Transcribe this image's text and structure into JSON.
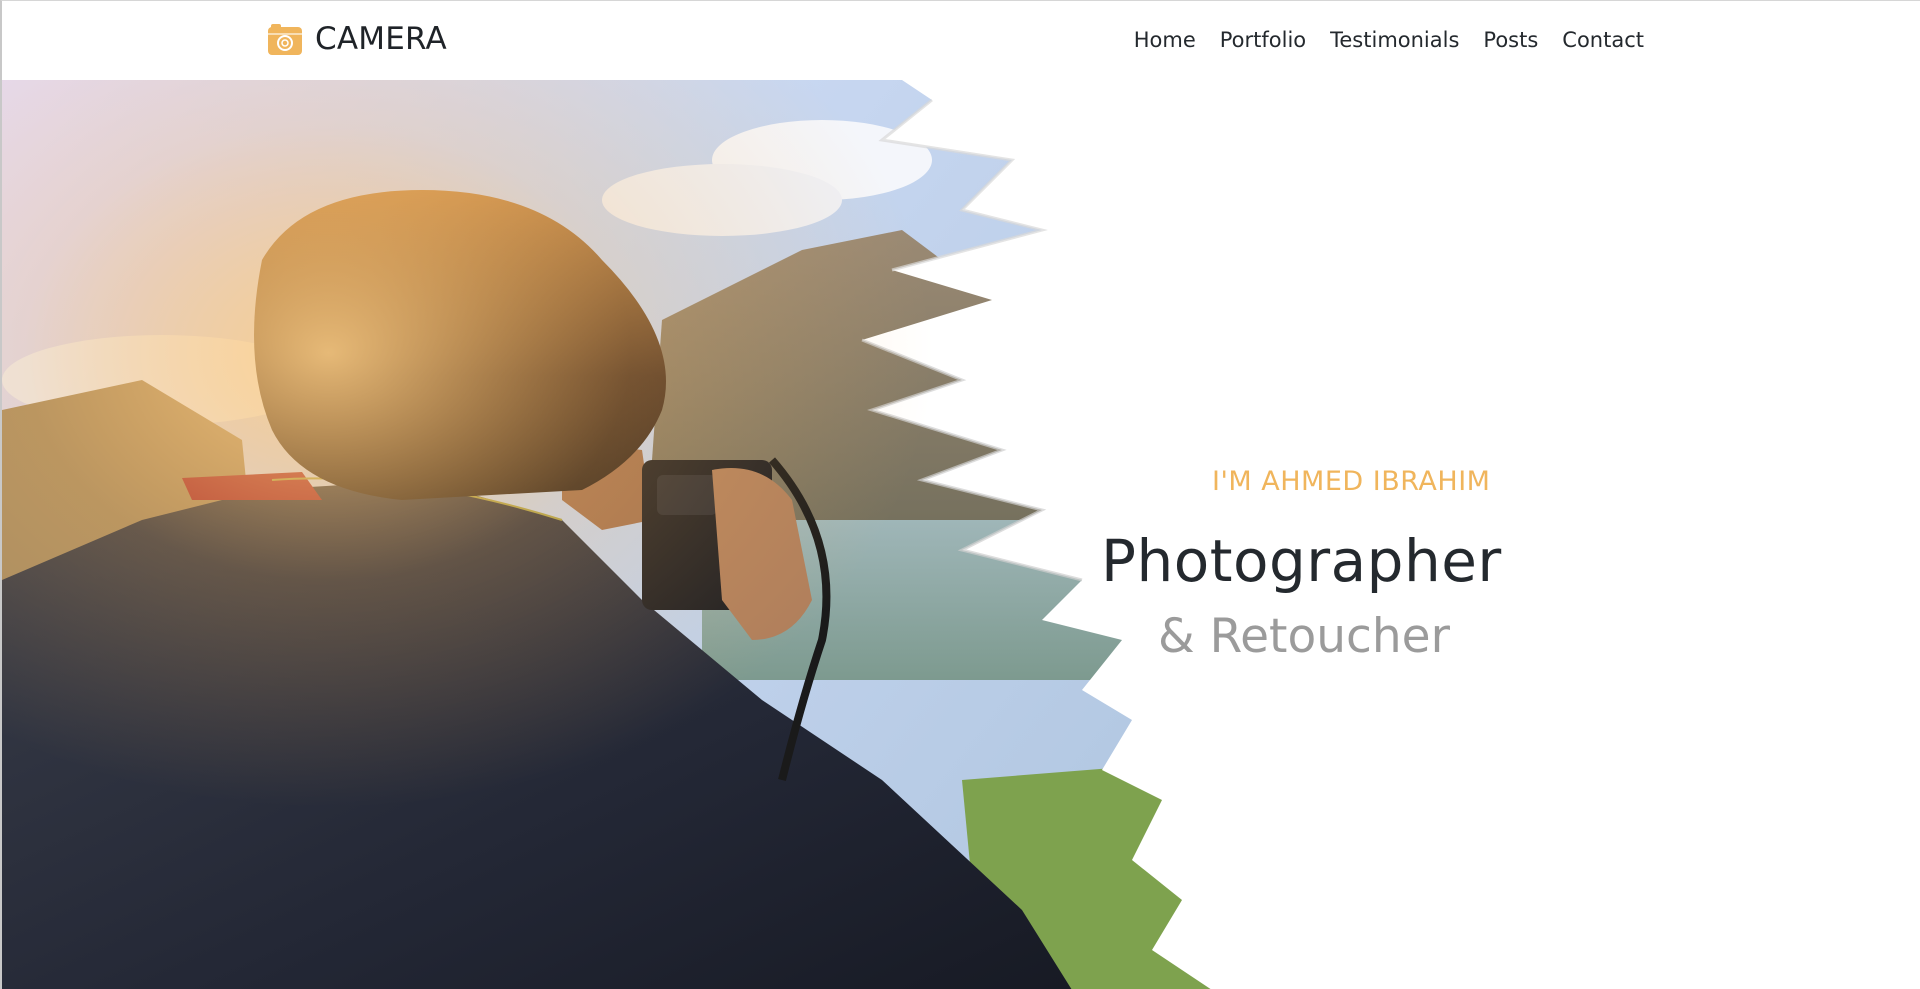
{
  "brand": {
    "name": "CAMERA",
    "icon": "camera-icon",
    "icon_color": "#f0b55c"
  },
  "nav": {
    "items": [
      {
        "label": "Home"
      },
      {
        "label": "Portfolio"
      },
      {
        "label": "Testimonials"
      },
      {
        "label": "Posts"
      },
      {
        "label": "Contact"
      }
    ]
  },
  "hero": {
    "intro": "I'M AHMED IBRAHIM",
    "title": "Photographer",
    "subtitle": "& Retoucher",
    "accent_color": "#f0b55c",
    "title_color": "#24292e",
    "subtitle_color": "#9b9b9b"
  }
}
